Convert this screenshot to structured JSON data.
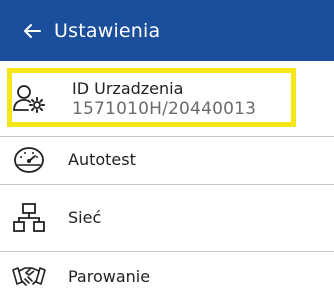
{
  "header": {
    "title": "Ustawienia",
    "back_icon": "arrow-left-icon"
  },
  "items": [
    {
      "label": "ID Urzadzenia",
      "value": "1571010H/20440013",
      "icon": "user-gear-icon",
      "highlighted": true
    },
    {
      "label": "Autotest",
      "icon": "speedometer-icon"
    },
    {
      "label": "Sieć",
      "icon": "network-icon"
    },
    {
      "label": "Parowanie",
      "icon": "handshake-icon"
    }
  ],
  "colors": {
    "header": "#1b4f9c",
    "highlight": "#f5e618"
  }
}
